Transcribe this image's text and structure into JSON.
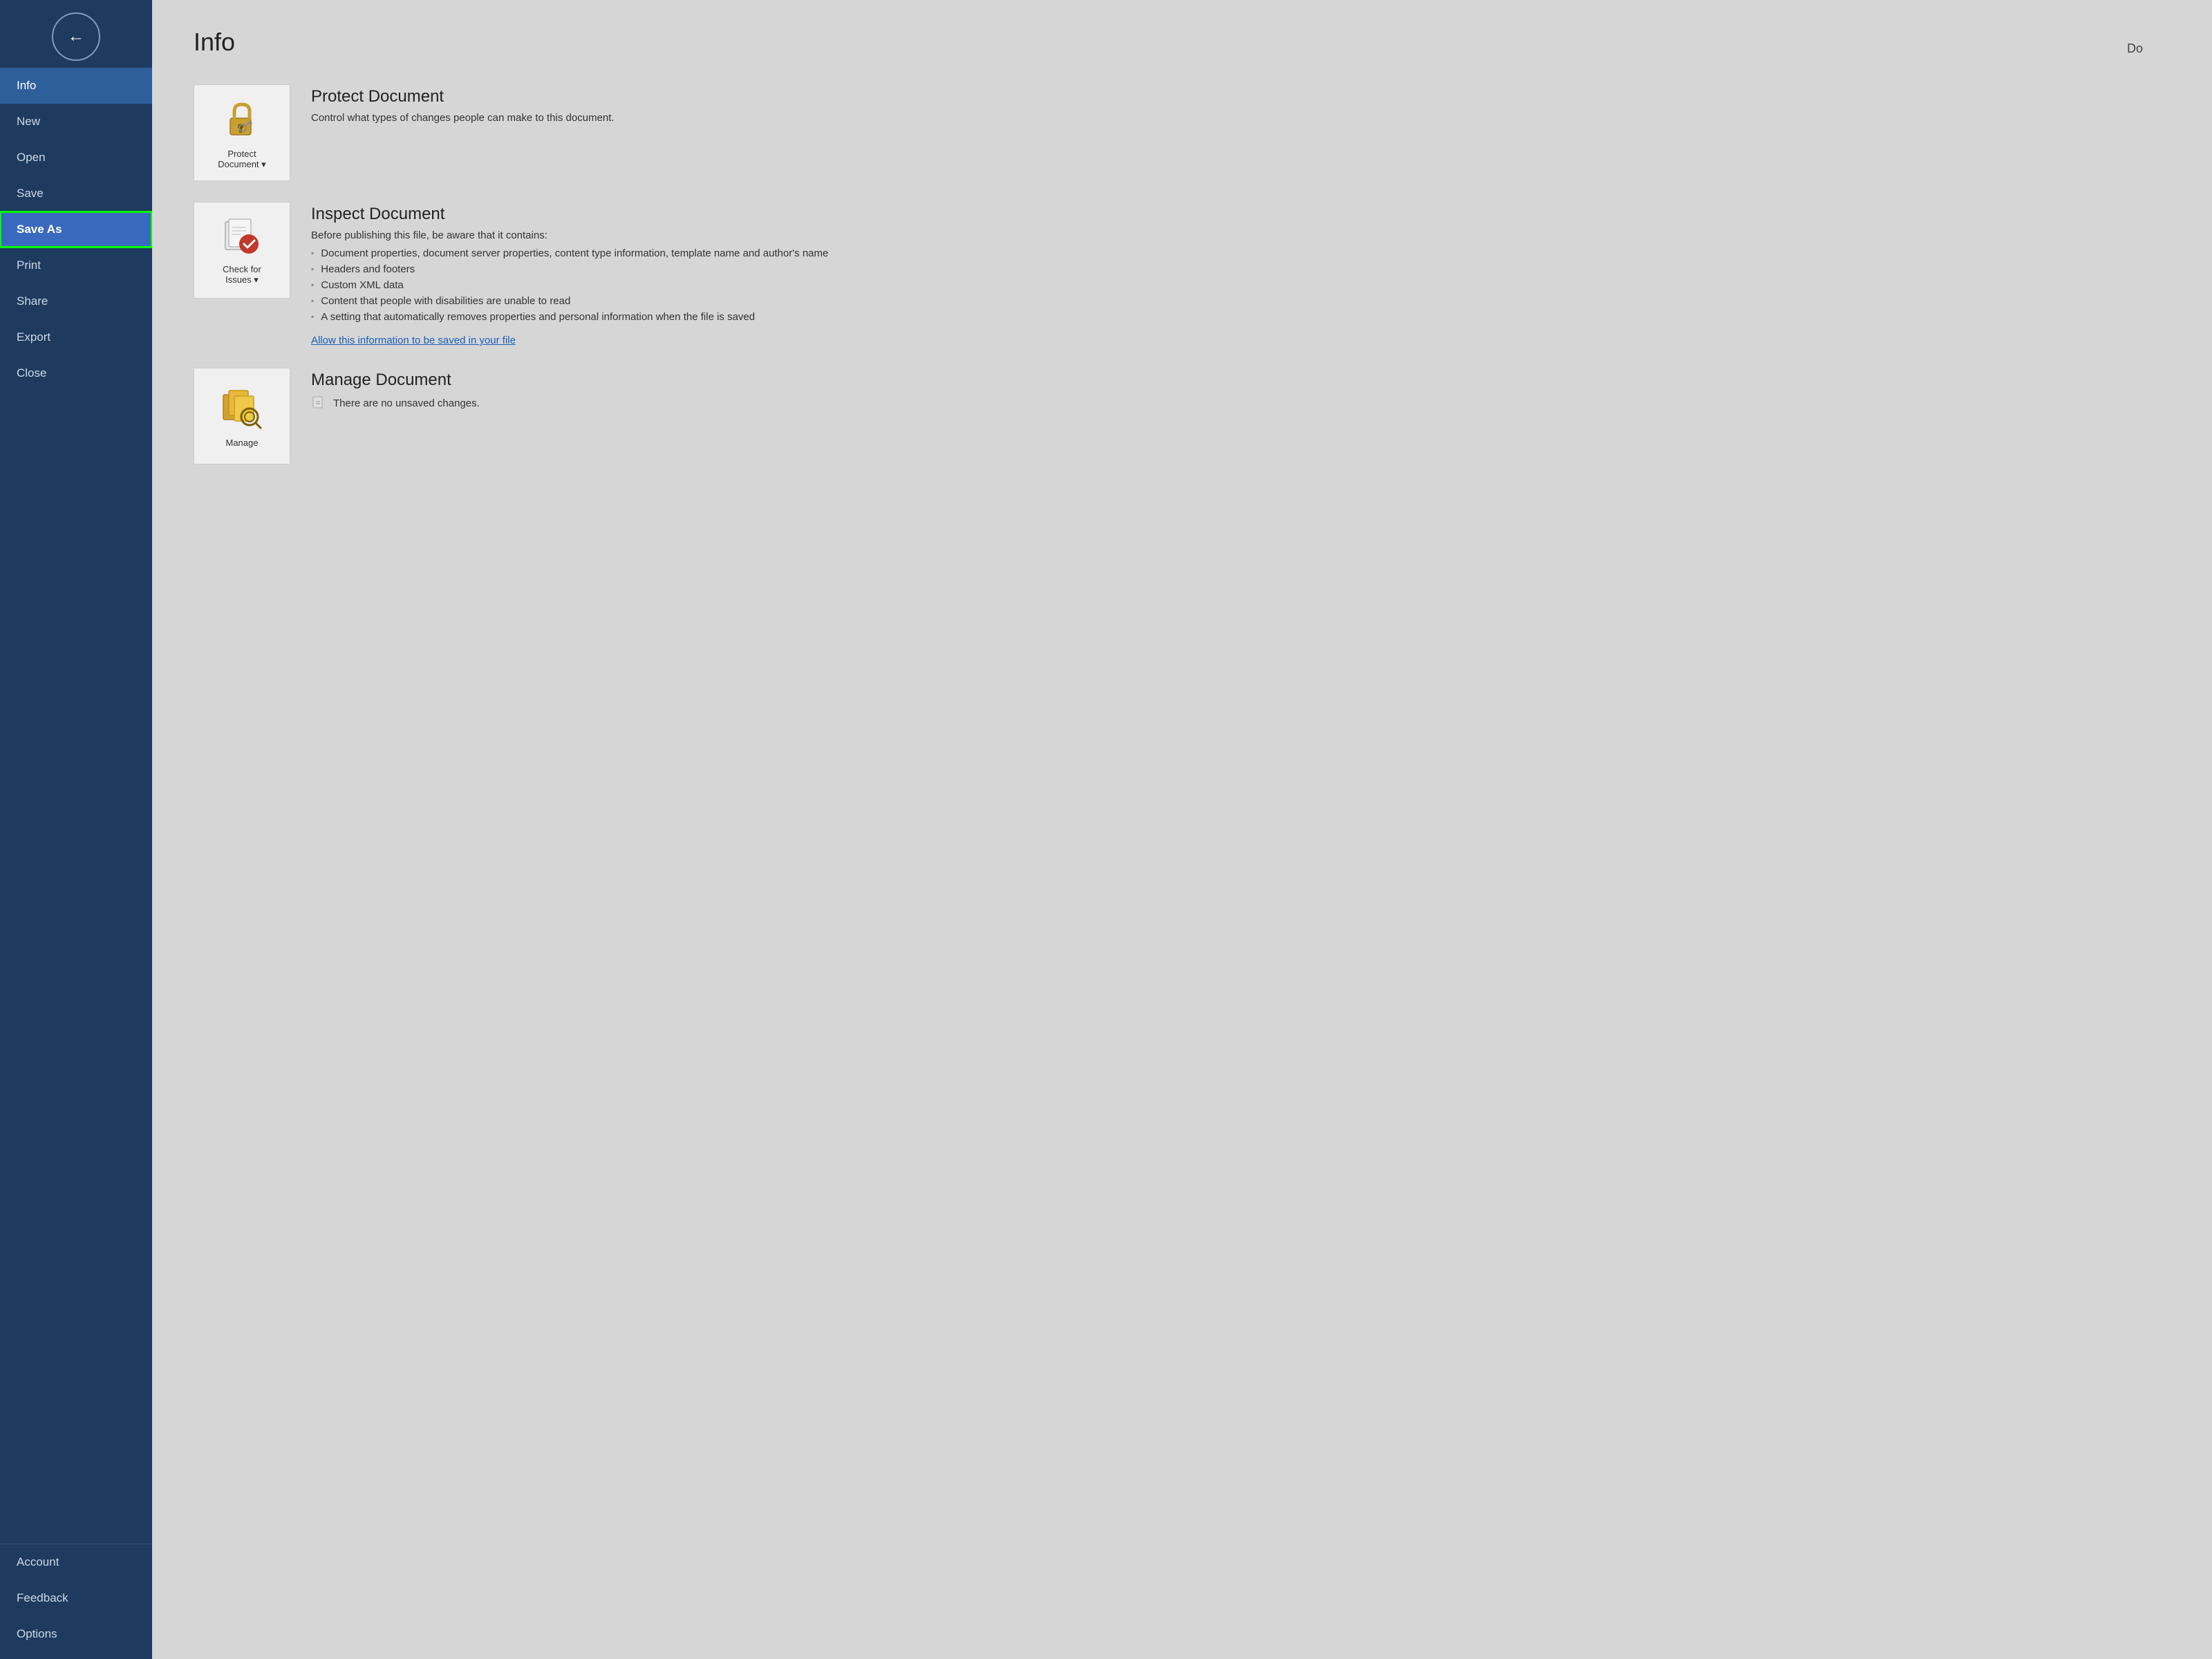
{
  "header": {
    "doc_label": "Do"
  },
  "sidebar": {
    "back_label": "←",
    "items": [
      {
        "id": "info",
        "label": "Info",
        "active": true,
        "saveas": false
      },
      {
        "id": "new",
        "label": "New",
        "active": false,
        "saveas": false
      },
      {
        "id": "open",
        "label": "Open",
        "active": false,
        "saveas": false
      },
      {
        "id": "save",
        "label": "Save",
        "active": false,
        "saveas": false
      },
      {
        "id": "save-as",
        "label": "Save As",
        "active": false,
        "saveas": true
      },
      {
        "id": "print",
        "label": "Print",
        "active": false,
        "saveas": false
      },
      {
        "id": "share",
        "label": "Share",
        "active": false,
        "saveas": false
      },
      {
        "id": "export",
        "label": "Export",
        "active": false,
        "saveas": false
      },
      {
        "id": "close",
        "label": "Close",
        "active": false,
        "saveas": false
      }
    ],
    "bottom_items": [
      {
        "id": "account",
        "label": "Account"
      },
      {
        "id": "feedback",
        "label": "Feedback"
      },
      {
        "id": "options",
        "label": "Options"
      }
    ]
  },
  "main": {
    "page_title": "Info",
    "cards": [
      {
        "id": "protect",
        "icon_label": "Protect\nDocument ▾",
        "title": "Protect Document",
        "desc": "Control what types of changes people can make to this document.",
        "bullets": [],
        "link": null
      },
      {
        "id": "inspect",
        "icon_label": "Check for\nIssues ▾",
        "title": "Inspect Document",
        "desc": "Before publishing this file, be aware that it contains:",
        "bullets": [
          "Document properties, document server properties, content type information, template name and author's name",
          "Headers and footers",
          "Custom XML data",
          "Content that people with disabilities are unable to read",
          "A setting that automatically removes properties and personal information when the file is saved"
        ],
        "link": "Allow this information to be saved in your file"
      },
      {
        "id": "manage",
        "icon_label": "Manage",
        "title": "Manage Document",
        "desc": null,
        "bullets": [],
        "unsaved": "There are no unsaved changes.",
        "link": null
      }
    ]
  }
}
